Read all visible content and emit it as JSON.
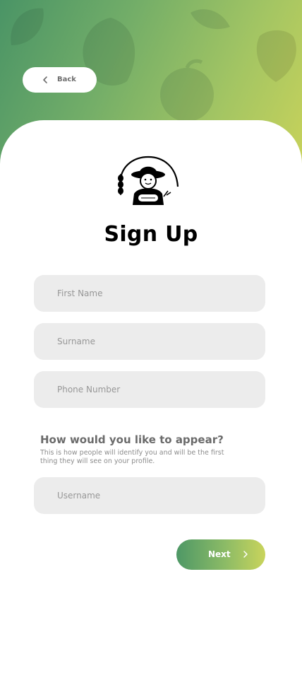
{
  "header": {
    "back_label": "Back"
  },
  "page": {
    "title": "Sign Up"
  },
  "form": {
    "first_name": {
      "placeholder": "First Name",
      "value": ""
    },
    "surname": {
      "placeholder": "Surname",
      "value": ""
    },
    "phone": {
      "placeholder": "Phone Number",
      "value": ""
    },
    "appear_heading": "How would you like to appear?",
    "appear_description": "This is how people will identify you and will be the first thing they will see on your profile.",
    "username": {
      "placeholder": "Username",
      "value": ""
    }
  },
  "footer": {
    "next_label": "Next"
  },
  "icons": {
    "back": "chevron-left-icon",
    "next": "chevron-right-icon",
    "logo": "farmer-logo-icon",
    "background": "produce-silhouettes"
  },
  "colors": {
    "gradient_start": "#4a9466",
    "gradient_end": "#cad35a",
    "field_bg": "#ececec",
    "title": "#000000"
  }
}
